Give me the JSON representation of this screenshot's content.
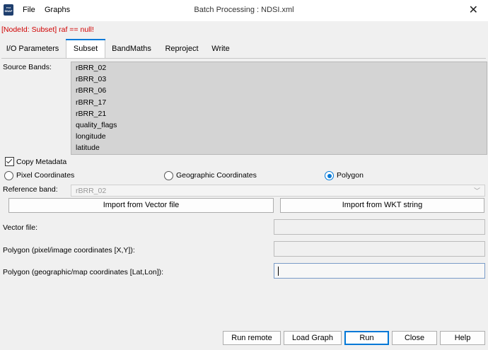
{
  "window": {
    "title": "Batch Processing : NDSI.xml",
    "app_icon_text_top": "esa",
    "app_icon_text_bottom": "SNAP",
    "close_glyph": "✕"
  },
  "menu": {
    "items": [
      "File",
      "Graphs"
    ]
  },
  "error_message": "[NodeId: Subset] raf == null!",
  "tabs": [
    {
      "label": "I/O Parameters",
      "active": false
    },
    {
      "label": "Subset",
      "active": true
    },
    {
      "label": "BandMaths",
      "active": false
    },
    {
      "label": "Reproject",
      "active": false
    },
    {
      "label": "Write",
      "active": false
    }
  ],
  "subset": {
    "source_bands_label": "Source Bands:",
    "source_bands": [
      "rBRR_02",
      "rBRR_03",
      "rBRR_06",
      "rBRR_17",
      "rBRR_21",
      "quality_flags",
      "longitude",
      "latitude"
    ],
    "copy_metadata_label": "Copy Metadata",
    "copy_metadata_checked": true,
    "coordinate_modes": [
      {
        "label": "Pixel Coordinates",
        "selected": false
      },
      {
        "label": "Geographic Coordinates",
        "selected": false
      },
      {
        "label": "Polygon",
        "selected": true
      }
    ],
    "reference_band_label": "Reference band:",
    "reference_band_value": "rBRR_02",
    "import_vector_label": "Import from Vector file",
    "import_wkt_label": "Import from WKT string",
    "vector_file_label": "Vector file:",
    "vector_file_value": "",
    "polygon_pixel_label": "Polygon (pixel/image coordinates [X,Y]):",
    "polygon_pixel_value": "",
    "polygon_geo_label": "Polygon (geographic/map coordinates [Lat,Lon]):",
    "polygon_geo_value": ""
  },
  "footer": {
    "run_remote": "Run remote",
    "load_graph": "Load Graph",
    "run": "Run",
    "close": "Close",
    "help": "Help"
  },
  "icons": {
    "app": "snap-logo-icon",
    "close": "close-icon",
    "dropdown": "chevron-down-icon"
  },
  "colors": {
    "error": "#d00000",
    "accent": "#0078d7",
    "list_background": "#d4d4d4"
  }
}
